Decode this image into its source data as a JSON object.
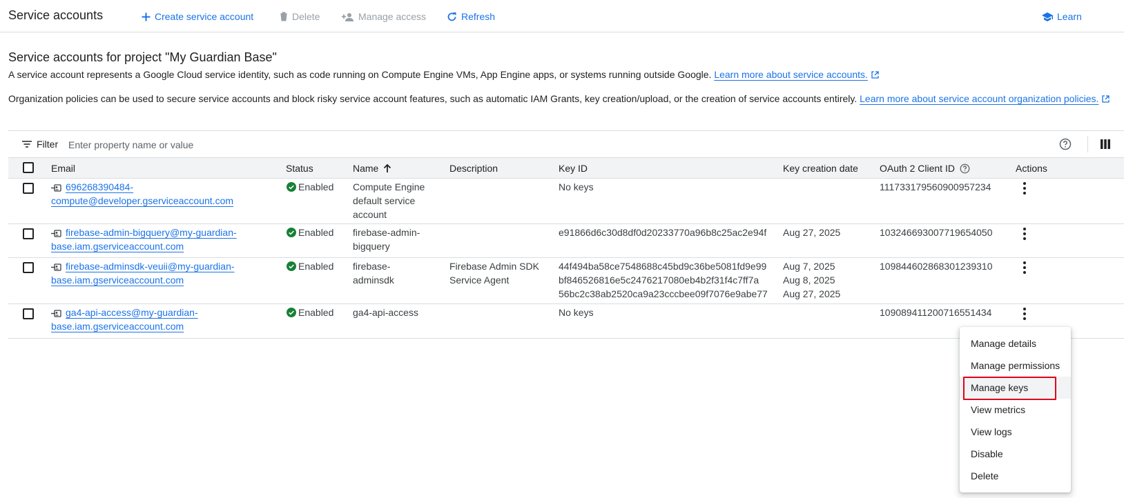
{
  "header": {
    "title": "Service accounts",
    "create_label": "Create service account",
    "delete_label": "Delete",
    "manage_access_label": "Manage access",
    "refresh_label": "Refresh",
    "learn_label": "Learn"
  },
  "intro": {
    "title": "Service accounts for project \"My Guardian Base\"",
    "desc1": "A service account represents a Google Cloud service identity, such as code running on Compute Engine VMs, App Engine apps, or systems running outside Google.",
    "link1": "Learn more about service accounts.",
    "desc2": "Organization policies can be used to secure service accounts and block risky service account features, such as automatic IAM Grants, key creation/upload, or the creation of service accounts entirely.",
    "link2": "Learn more about service account organization policies."
  },
  "filter": {
    "label": "Filter",
    "placeholder": "Enter property name or value"
  },
  "table": {
    "columns": {
      "email": "Email",
      "status": "Status",
      "name": "Name",
      "description": "Description",
      "key_id": "Key ID",
      "key_date": "Key creation date",
      "oauth": "OAuth 2 Client ID",
      "actions": "Actions"
    },
    "rows": [
      {
        "email_1": "696268390484-",
        "email_2": "compute@developer.gserviceaccount.com",
        "status": "Enabled",
        "name_1": "Compute Engine",
        "name_2": "default service",
        "name_3": "account",
        "description_1": "",
        "description_2": "",
        "key_1": "No keys",
        "key_2": "",
        "key_3": "",
        "date_1": "",
        "date_2": "",
        "date_3": "",
        "oauth": "111733179560900957234"
      },
      {
        "email_1": "firebase-admin-bigquery@my-guardian-",
        "email_2": "base.iam.gserviceaccount.com",
        "status": "Enabled",
        "name_1": "firebase-admin-",
        "name_2": "bigquery",
        "name_3": "",
        "description_1": "",
        "description_2": "",
        "key_1": "e91866d6c30d8df0d20233770a96b8c25ac2e94f",
        "key_2": "",
        "key_3": "",
        "date_1": "Aug 27, 2025",
        "date_2": "",
        "date_3": "",
        "oauth": "103246693007719654050"
      },
      {
        "email_1": "firebase-adminsdk-veuii@my-guardian-",
        "email_2": "base.iam.gserviceaccount.com",
        "status": "Enabled",
        "name_1": "firebase-",
        "name_2": "adminsdk",
        "name_3": "",
        "description_1": "Firebase Admin SDK",
        "description_2": "Service Agent",
        "key_1": "44f494ba58ce7548688c45bd9c36be5081fd9e99",
        "key_2": "bf846526816e5c2476217080eb4b2f31f4c7ff7a",
        "key_3": "56bc2c38ab2520ca9a23cccbee09f7076e9abe77",
        "date_1": "Aug 7, 2025",
        "date_2": "Aug 8, 2025",
        "date_3": "Aug 27, 2025",
        "oauth": "109844602868301239310"
      },
      {
        "email_1": "ga4-api-access@my-guardian-",
        "email_2": "base.iam.gserviceaccount.com",
        "status": "Enabled",
        "name_1": "ga4-api-access",
        "name_2": "",
        "name_3": "",
        "description_1": "",
        "description_2": "",
        "key_1": "No keys",
        "key_2": "",
        "key_3": "",
        "date_1": "",
        "date_2": "",
        "date_3": "",
        "oauth": "109089411200716551434"
      }
    ]
  },
  "menu": {
    "items": [
      "Manage details",
      "Manage permissions",
      "Manage keys",
      "View metrics",
      "View logs",
      "Disable",
      "Delete"
    ],
    "highlighted": "Manage keys"
  },
  "colors": {
    "accent": "#1a73e8",
    "enabled_green": "#188038",
    "highlight_border": "#e0001b",
    "disabled_text": "#9aa0a6"
  }
}
